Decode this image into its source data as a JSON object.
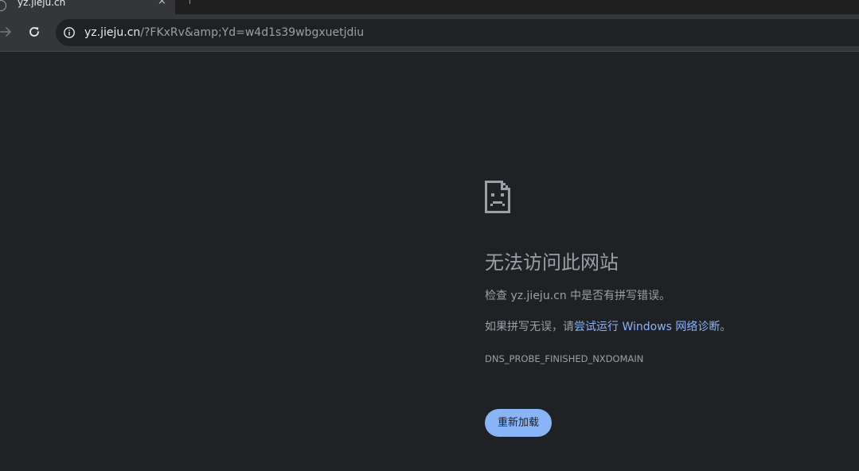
{
  "tab": {
    "title": "yz.jieju.cn",
    "close_glyph": "×",
    "favicon": "globe-icon"
  },
  "toolbar": {
    "forward_icon": "arrow-forward-icon",
    "reload_icon": "reload-icon"
  },
  "omnibox": {
    "site_info_icon": "info-circle-icon",
    "url_host": "yz.jieju.cn",
    "url_rest": "/?FKxRv&amp;Yd=w4d1s39wbgxuetjdiu"
  },
  "error_page": {
    "icon": "sad-page-icon",
    "heading": "无法访问此网站",
    "check_prefix": "检查 ",
    "check_host": "yz.jieju.cn",
    "check_suffix": " 中是否有拼写错误。",
    "hint_prefix": "如果拼写无误，请",
    "hint_link": "尝试运行 Windows 网络诊断",
    "hint_suffix": "。",
    "error_code": "DNS_PROBE_FINISHED_NXDOMAIN",
    "reload_label": "重新加载"
  },
  "colors": {
    "background": "#202124",
    "toolbar": "#35363a",
    "text_secondary": "#9aa0a6",
    "accent": "#8ab4f8"
  }
}
